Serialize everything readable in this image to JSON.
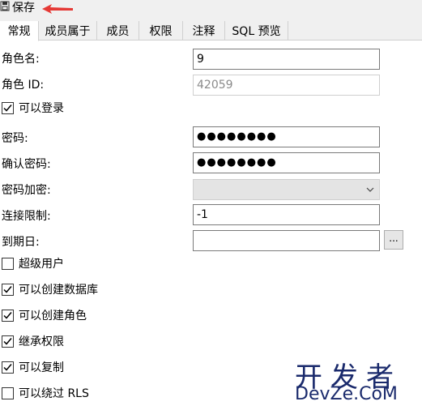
{
  "toolbar": {
    "save_label": "保存"
  },
  "tabs": [
    {
      "label": "常规"
    },
    {
      "label": "成员属于"
    },
    {
      "label": "成员"
    },
    {
      "label": "权限"
    },
    {
      "label": "注释"
    },
    {
      "label": "SQL 预览"
    }
  ],
  "form": {
    "role_name": {
      "label": "角色名:",
      "value": "9"
    },
    "role_id": {
      "label": "角色 ID:",
      "value": "42059"
    },
    "can_login": {
      "label": "可以登录",
      "checked": true
    },
    "password": {
      "label": "密码:",
      "value": "●●●●●●●●"
    },
    "confirm_password": {
      "label": "确认密码:",
      "value": "●●●●●●●●"
    },
    "password_encryption": {
      "label": "密码加密:",
      "value": ""
    },
    "connection_limit": {
      "label": "连接限制:",
      "value": "-1"
    },
    "expiration": {
      "label": "到期日:",
      "value": "",
      "button": "..."
    }
  },
  "options": [
    {
      "label": "超级用户",
      "checked": false
    },
    {
      "label": "可以创建数据库",
      "checked": true
    },
    {
      "label": "可以创建角色",
      "checked": true
    },
    {
      "label": "继承权限",
      "checked": true
    },
    {
      "label": "可以复制",
      "checked": true
    },
    {
      "label": "可以绕过 RLS",
      "checked": false
    }
  ],
  "watermark": {
    "top": "开发者",
    "bottom": "DevZe.CoM"
  },
  "colors": {
    "arrow": "#e53935",
    "tab_border": "#d0d0d0",
    "toolbar_bg": "#f0f0f0"
  }
}
